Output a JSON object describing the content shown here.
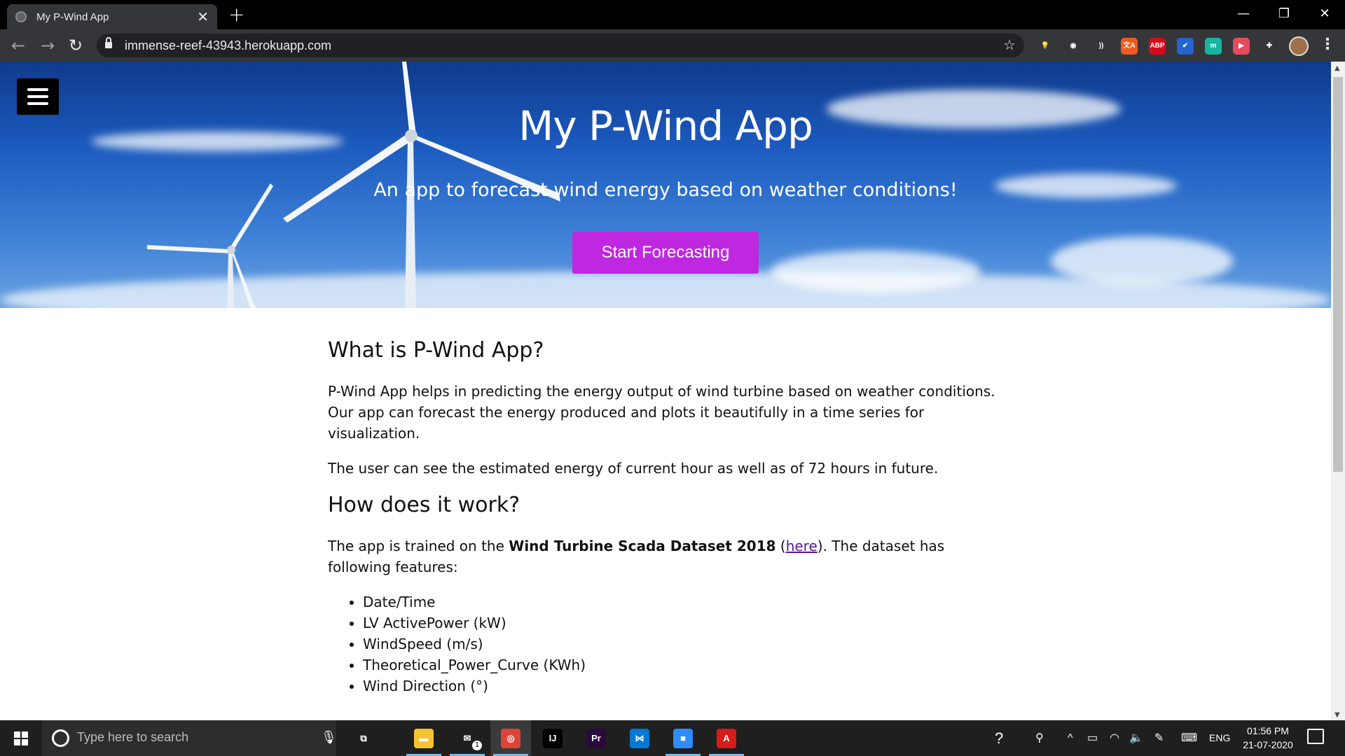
{
  "browser": {
    "tab_title": "My P-Wind App",
    "tab_close": "✕",
    "new_tab": "+",
    "url": "immense-reef-43943.herokuapp.com",
    "window_controls": {
      "minimize": "—",
      "restore": "❐",
      "close": "✕"
    },
    "extensions": [
      {
        "name": "bulb-extension-icon",
        "label": "💡",
        "color": "#35363a"
      },
      {
        "name": "owl-extension-icon",
        "label": "◉",
        "color": "#35363a"
      },
      {
        "name": "wave-extension-icon",
        "label": "))",
        "color": "#35363a"
      },
      {
        "name": "translate-extension-icon",
        "label": "文A",
        "color": "#f05a22"
      },
      {
        "name": "adblock-plus-icon",
        "label": "ABP",
        "color": "#d70a1b"
      },
      {
        "name": "todo-check-icon",
        "label": "✔",
        "color": "#2564cf"
      },
      {
        "name": "m-extension-icon",
        "label": "m",
        "color": "#15b5a0"
      },
      {
        "name": "video-extension-icon",
        "label": "▶",
        "color": "#e64a5d"
      },
      {
        "name": "puzzle-extensions-icon",
        "label": "✚",
        "color": "#35363a"
      }
    ]
  },
  "hero": {
    "title": "My P-Wind App",
    "subtitle": "An app to forecast wind energy based on weather conditions!",
    "cta_label": "Start Forecasting",
    "cta_color": "#c027e0"
  },
  "content": {
    "section1_title": "What is P-Wind App?",
    "section1_p1": "P-Wind App helps in predicting the energy output of wind turbine based on weather conditions. Our app can forecast the energy produced and plots it beautifully in a time series for visualization.",
    "section1_p2": "The user can see the estimated energy of current hour as well as of 72 hours in future.",
    "section2_title": "How does it work?",
    "section2_p_pre": "The app is trained on the ",
    "section2_dataset": "Wind Turbine Scada Dataset 2018",
    "section2_p_open": " (",
    "section2_link": "here",
    "section2_p_post": "). The dataset has following features:",
    "features": [
      "Date/Time",
      "LV ActivePower (kW)",
      "WindSpeed (m/s)",
      "Theoretical_Power_Curve (KWh)",
      "Wind Direction (°)"
    ]
  },
  "taskbar": {
    "search_placeholder": "Type here to search",
    "apps": [
      {
        "name": "taskview-app",
        "label": "⧉",
        "color": "#1f1f1f"
      },
      {
        "name": "file-explorer-app",
        "label": "▬",
        "color": "#f4c430"
      },
      {
        "name": "mail-app",
        "label": "✉",
        "color": "#1f1f1f"
      },
      {
        "name": "chrome-app",
        "label": "◎",
        "color": "#db4437"
      },
      {
        "name": "intellij-app",
        "label": "IJ",
        "color": "#000000"
      },
      {
        "name": "premiere-pro-app",
        "label": "Pr",
        "color": "#2a0a3d"
      },
      {
        "name": "vscode-app",
        "label": "⋈",
        "color": "#0078d4"
      },
      {
        "name": "zoom-app",
        "label": "■",
        "color": "#2d8cff"
      },
      {
        "name": "acrobat-app",
        "label": "A",
        "color": "#d71a1a"
      }
    ],
    "mail_badge": "1",
    "language": "ENG",
    "time": "01:56 PM",
    "date": "21-07-2020"
  }
}
